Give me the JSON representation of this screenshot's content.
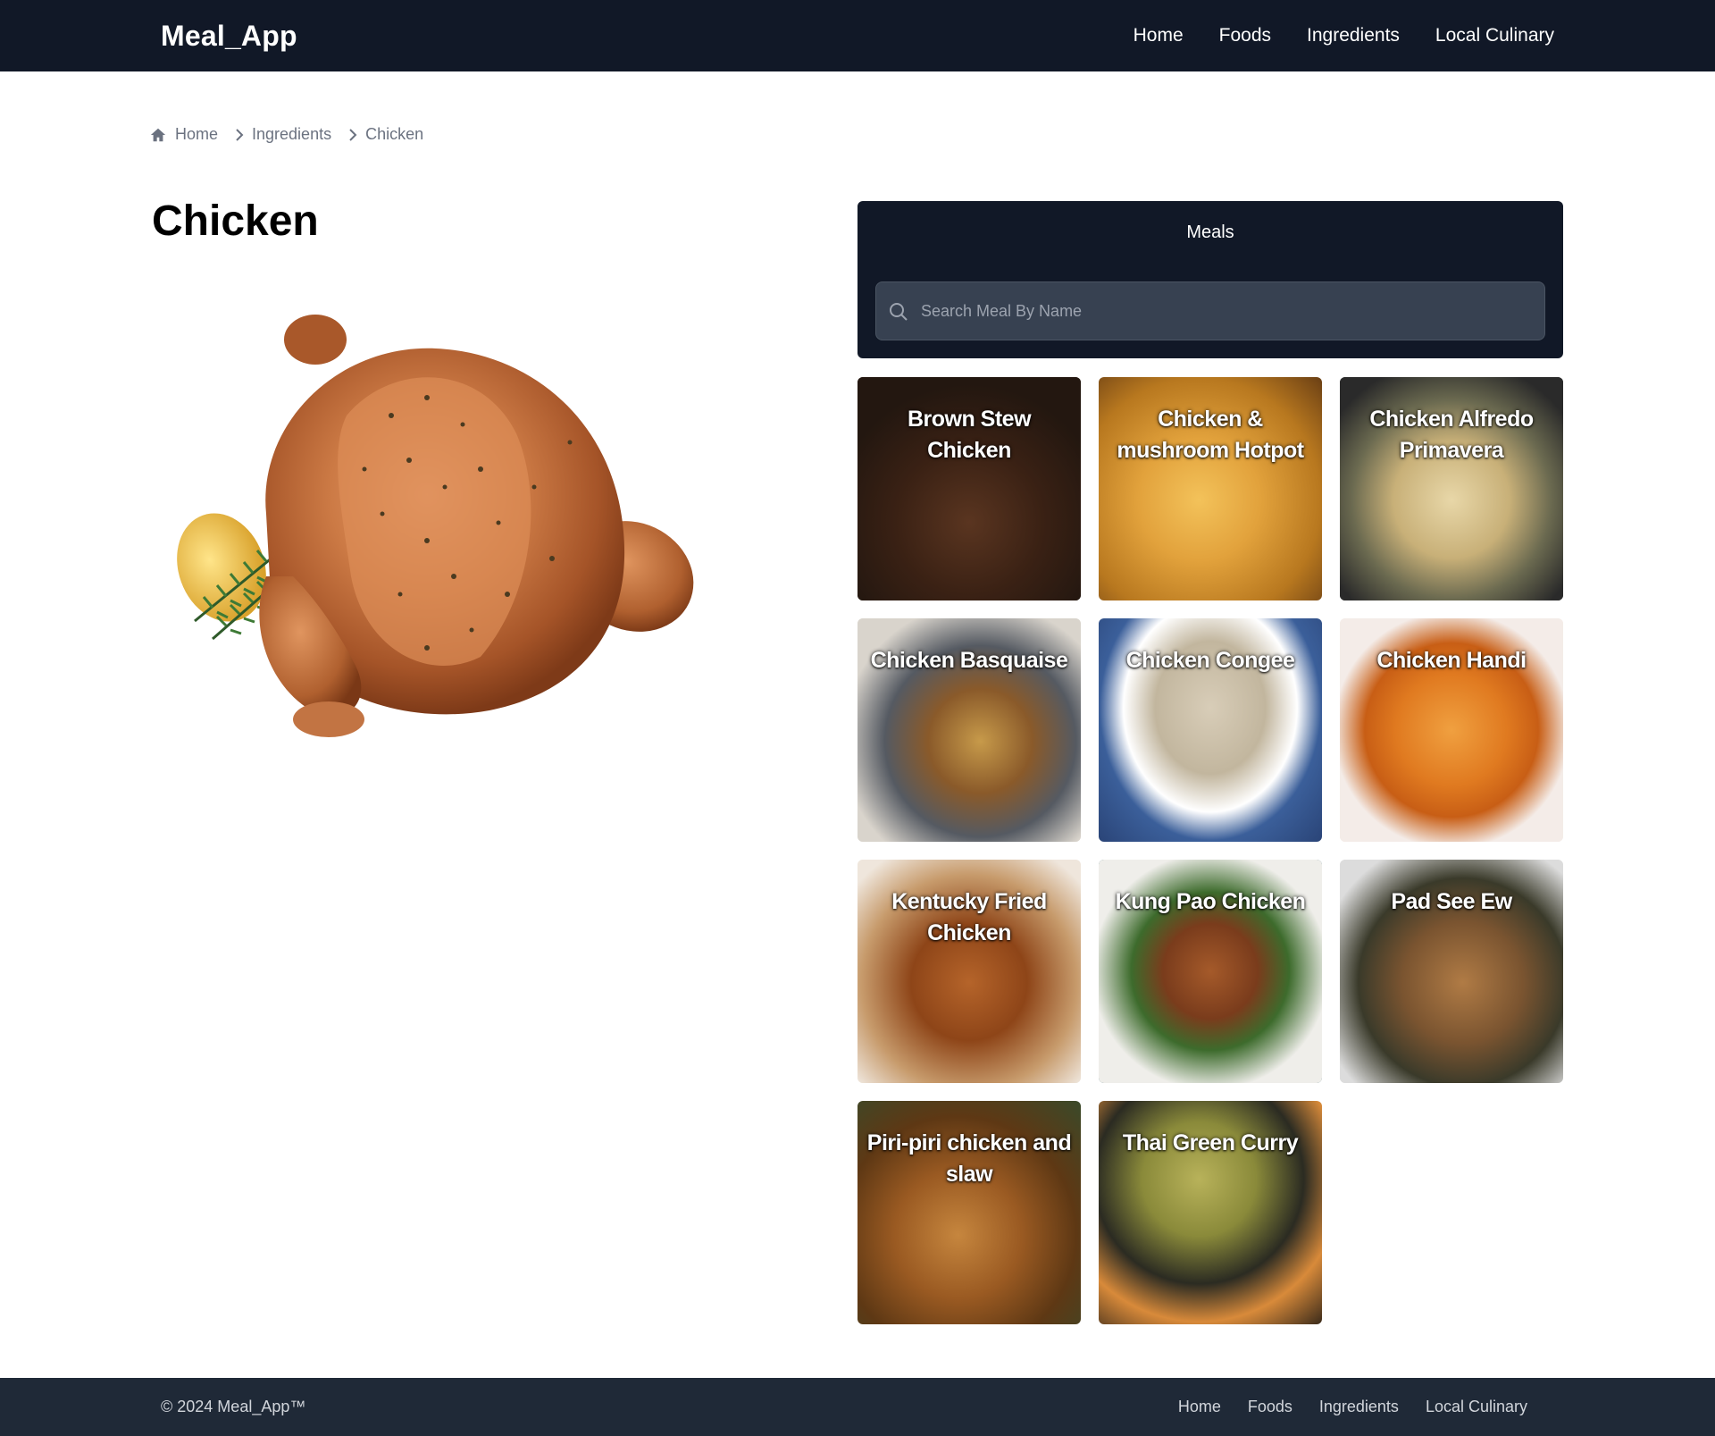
{
  "header": {
    "brand": "Meal_App",
    "nav": [
      {
        "label": "Home"
      },
      {
        "label": "Foods"
      },
      {
        "label": "Ingredients"
      },
      {
        "label": "Local Culinary"
      }
    ]
  },
  "breadcrumb": {
    "items": [
      {
        "label": "Home",
        "icon": "home-icon"
      },
      {
        "label": "Ingredients"
      },
      {
        "label": "Chicken"
      }
    ]
  },
  "ingredient": {
    "title": "Chicken",
    "image_alt": "roast-chicken"
  },
  "meals": {
    "title": "Meals",
    "search_placeholder": "Search Meal By Name",
    "search_value": "",
    "items": [
      {
        "name": "Brown Stew Chicken"
      },
      {
        "name": "Chicken & mushroom Hotpot"
      },
      {
        "name": "Chicken Alfredo Primavera"
      },
      {
        "name": "Chicken Basquaise"
      },
      {
        "name": "Chicken Congee"
      },
      {
        "name": "Chicken Handi"
      },
      {
        "name": "Kentucky Fried Chicken"
      },
      {
        "name": "Kung Pao Chicken"
      },
      {
        "name": "Pad See Ew"
      },
      {
        "name": "Piri-piri chicken and slaw"
      },
      {
        "name": "Thai Green Curry"
      }
    ]
  },
  "footer": {
    "copyright": "© 2024 Meal_App™",
    "nav": [
      {
        "label": "Home"
      },
      {
        "label": "Foods"
      },
      {
        "label": "Ingredients"
      },
      {
        "label": "Local Culinary"
      }
    ]
  },
  "colors": {
    "nav_bg": "#111827",
    "footer_bg": "#1f2937",
    "panel_bg": "#111827",
    "search_bg": "#374151"
  }
}
